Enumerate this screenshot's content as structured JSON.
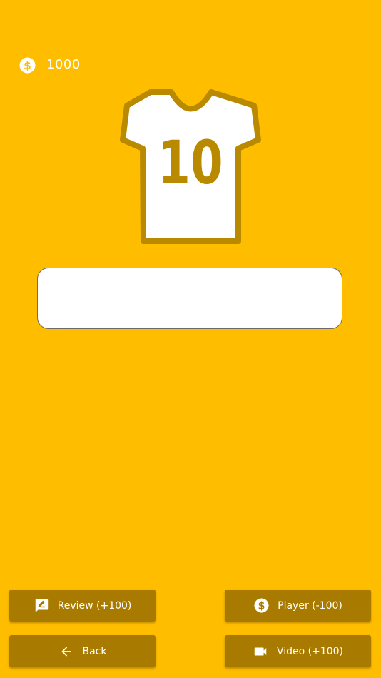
{
  "header": {
    "coin_icon": "dollar-coin-icon",
    "coins": "1000"
  },
  "jersey": {
    "number": "10",
    "icon": "jersey-icon"
  },
  "answer": {
    "value": "",
    "placeholder": ""
  },
  "buttons": {
    "review": {
      "label": "Review (+100)",
      "icon": "rate-review-icon"
    },
    "player": {
      "label": "Player (-100)",
      "icon": "dollar-coin-icon"
    },
    "back": {
      "label": "Back",
      "icon": "arrow-back-icon"
    },
    "video": {
      "label": "Video (+100)",
      "icon": "videocam-icon"
    }
  },
  "colors": {
    "background": "#FFBD00",
    "button": "#A87B00",
    "jersey_outline": "#B98A00",
    "text": "#FFFFFF"
  }
}
